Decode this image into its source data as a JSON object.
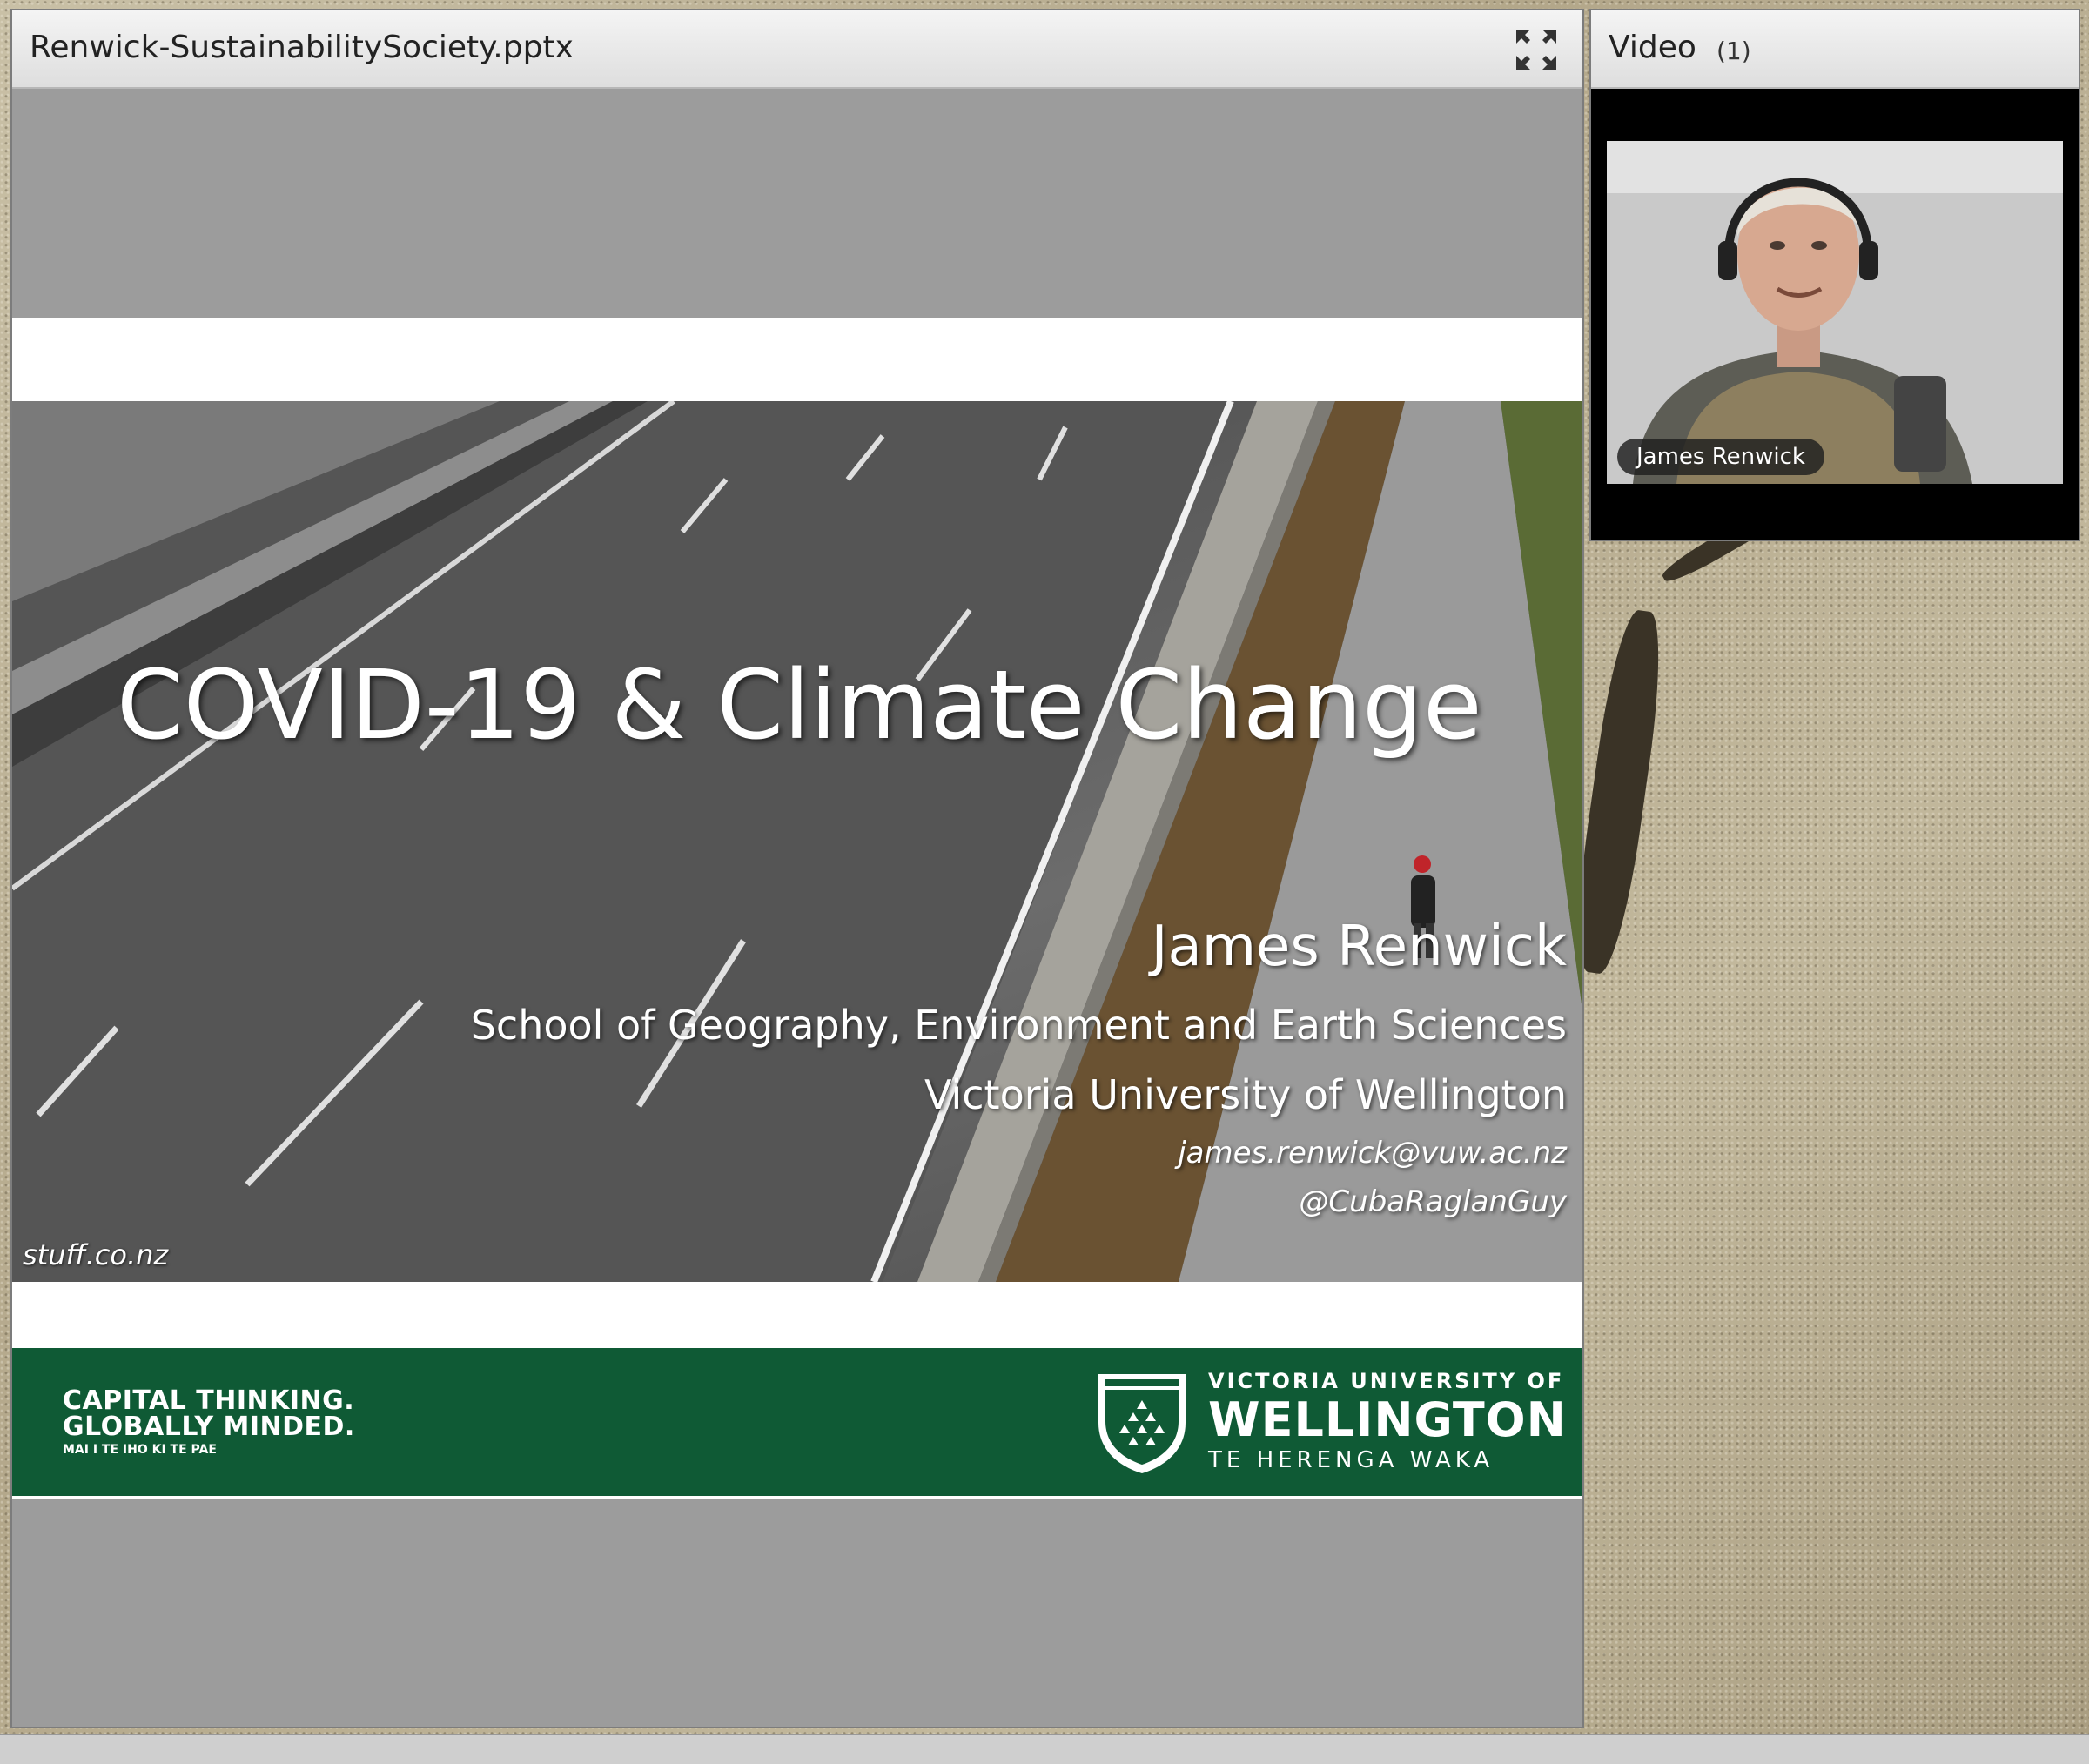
{
  "share_pod": {
    "title": "Renwick-SustainabilitySociety.pptx",
    "fullscreen_icon": "fullscreen-icon"
  },
  "slide": {
    "title": "COVID-19 & Climate Change",
    "presenter": "James Renwick",
    "school": "School of Geography, Environment and Earth Sciences",
    "university": "Victoria University of Wellington",
    "email": "james.renwick@vuw.ac.nz",
    "handle": "@CubaRaglanGuy",
    "photo_credit": "stuff.co.nz",
    "footer": {
      "tagline_1": "CAPITAL THINKING.",
      "tagline_2": "GLOBALLY MINDED.",
      "tagline_3": "MAI I TE IHO KI TE PAE",
      "logo_line_1": "VICTORIA UNIVERSITY OF",
      "logo_line_2": "WELLINGTON",
      "logo_line_3": "TE HERENGA WAKA",
      "brand_color": "#0f5a35"
    }
  },
  "video_pod": {
    "title": "Video",
    "count": "(1)",
    "participant_name": "James Renwick"
  }
}
